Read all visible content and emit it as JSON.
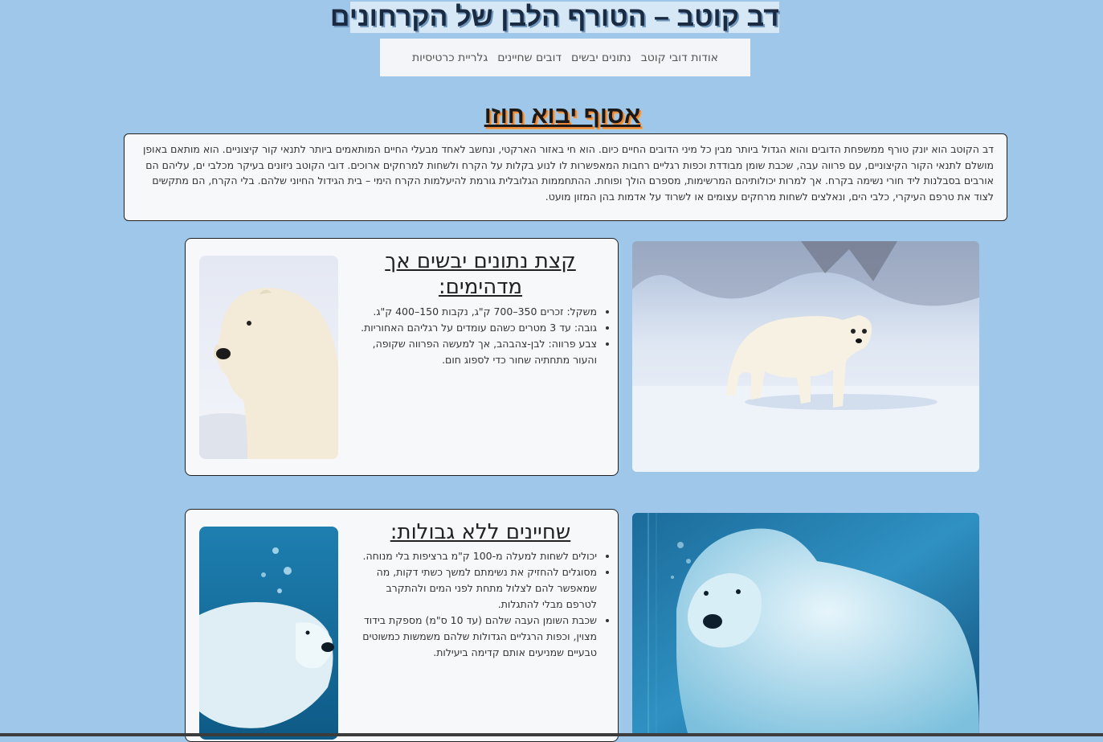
{
  "header": {
    "title": "דב קוטב – הטורף הלבן של הקרחונים"
  },
  "nav": {
    "items": [
      "אודות דובי קוטב",
      "נתונים יבשים",
      "דובים שחיינים",
      "גלריית כרטיסיות"
    ]
  },
  "section": {
    "subtitle": "אסוף יבוא חוזו",
    "intro": "דב הקוטב הוא יונק טורף ממשפחת הדובים והוא הגדול ביותר מבין כל מיני הדובים החיים כיום. הוא חי באזור הארקטי, ונחשב לאחד מבעלי החיים המותאמים ביותר לתנאי קור קיצוניים. הוא מותאם באופן מושלם לתנאי הקור הקיצוניים, עם פרווה עבה, שכבת שומן מבודדת וכפות רגליים רחבות המאפשרות לו לנוע בקלות על הקרח ולשחות למרחקים ארוכים. דובי הקוטב ניזונים בעיקר מכלבי ים, עליהם הם אורבים בסבלנות ליד חורי נשימה בקרח. אך למרות יכולותיהם המרשימות, מספרם הולך ופוחת. ההתחממות הגלובלית גורמת להיעלמות הקרח הימי – בית הגידול החיוני שלהם. בלי הקרח, הם מתקשים לצוד את טרפם העיקרי, כלבי הים, ונאלצים לשחות מרחקים עצומים או לשרוד על אדמות בהן המזון מועט."
  },
  "cards": [
    {
      "title": "קצת נתונים יבשים אך מדהימים:",
      "bullets": [
        "משקל: זכרים 350–700 ק\"ג, נקבות 150–400 ק\"ג.",
        "גובה: עד 3 מטרים כשהם עומדים על רגליהם האחוריות.",
        "צבע פרווה: לבן-צהבהב, אך למעשה הפרווה שקופה, והעור מתחתיה שחור כדי לספוג חום."
      ]
    },
    {
      "title": "שחיינים ללא גבולות:",
      "bullets": [
        "יכולים לשחות למעלה מ-100 ק\"מ ברציפות בלי מנוחה.",
        "מסוגלים להחזיק את נשימתם למשך כשתי דקות, מה שמאפשר להם לצלול מתחת לפני המים ולהתקרב לטרפם מבלי להתגלות.",
        "שכבת השומן העבה שלהם (עד 10 ס\"מ) מספקת בידוד מצוין, וכפות הרגליים הגדולות שלהם משמשות כמשוטים טבעיים שמניעים אותם קדימה ביעילות."
      ]
    }
  ],
  "icons": {
    "photo1": "polar-bear-walking-on-snow-photo",
    "thumb1": "polar-bear-portrait-photo",
    "photo2": "polar-bear-underwater-photo",
    "thumb2": "polar-bear-swimming-photo"
  },
  "colors": {
    "background": "#9ec7ea",
    "card": "#f7f8fa",
    "subtitle_shadow": "#e8863a"
  }
}
